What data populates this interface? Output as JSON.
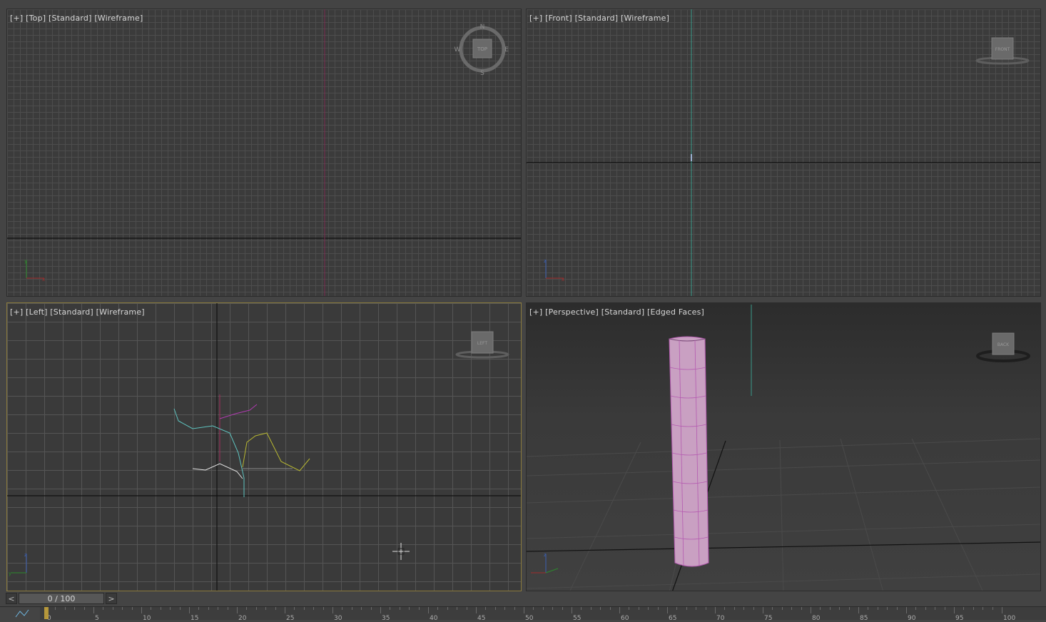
{
  "viewports": {
    "top": {
      "plus": "[+]",
      "view": "[Top]",
      "shading": "[Standard]",
      "mode": "[Wireframe]"
    },
    "front": {
      "plus": "[+]",
      "view": "[Front]",
      "shading": "[Standard]",
      "mode": "[Wireframe]"
    },
    "left": {
      "plus": "[+]",
      "view": "[Left]",
      "shading": "[Standard]",
      "mode": "[Wireframe]"
    },
    "perspective": {
      "plus": "[+]",
      "view": "[Perspective]",
      "shading": "[Standard]",
      "mode": "[Edged Faces]"
    }
  },
  "viewcube": {
    "top_face": "TOP",
    "front_face": "FRONT",
    "left_face": "LEFT",
    "persp_face": "BACK",
    "compass": {
      "n": "N",
      "s": "S",
      "e": "E",
      "w": "W"
    }
  },
  "axis_labels": {
    "x": "x",
    "y": "y",
    "z": "z"
  },
  "timeline": {
    "prev": "<",
    "next": ">",
    "frame_display": "0 / 100",
    "current_frame": 0,
    "total_frames": 100,
    "ticks": [
      "0",
      "5",
      "10",
      "15",
      "20",
      "25",
      "30",
      "35",
      "40",
      "45",
      "50",
      "55",
      "60",
      "65",
      "70",
      "75",
      "80",
      "85",
      "90",
      "95",
      "100"
    ]
  },
  "colors": {
    "active_border": "#8a7a3c",
    "object": "#d7a9cf",
    "bone_white": "#e6e6e6",
    "bone_cyan": "#5fc4c0",
    "bone_magenta": "#b03ab0",
    "bone_yellow": "#b8b832"
  }
}
